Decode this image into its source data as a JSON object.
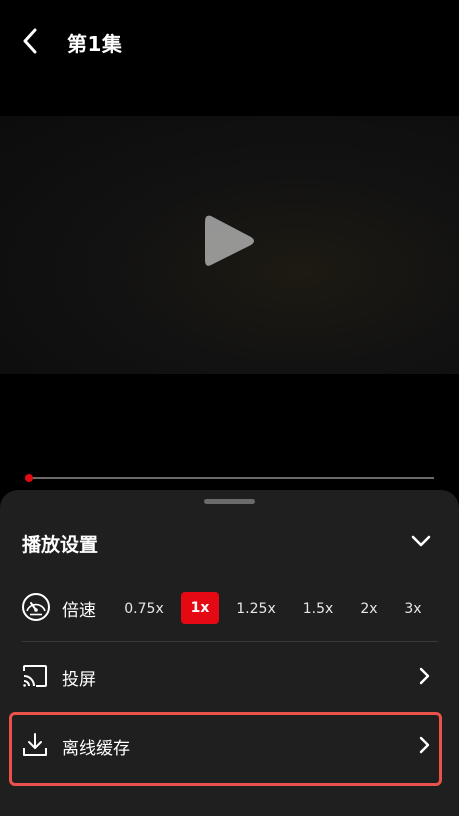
{
  "header": {
    "title": "第1集",
    "back_icon": "back-arrow-icon"
  },
  "player": {
    "play_icon": "play-icon",
    "progress_fraction": 0.0,
    "accent": "#e50914"
  },
  "settings_sheet": {
    "title": "播放设置",
    "collapse_icon": "chevron-down-icon",
    "speed": {
      "icon": "speedometer-icon",
      "label": "倍速",
      "options": [
        "0.75x",
        "1x",
        "1.25x",
        "1.5x",
        "2x",
        "3x"
      ],
      "selected": "1x"
    },
    "cast": {
      "icon": "cast-icon",
      "label": "投屏"
    },
    "offline_cache": {
      "icon": "download-icon",
      "label": "离线缓存"
    },
    "highlight_color": "#e8524a"
  }
}
